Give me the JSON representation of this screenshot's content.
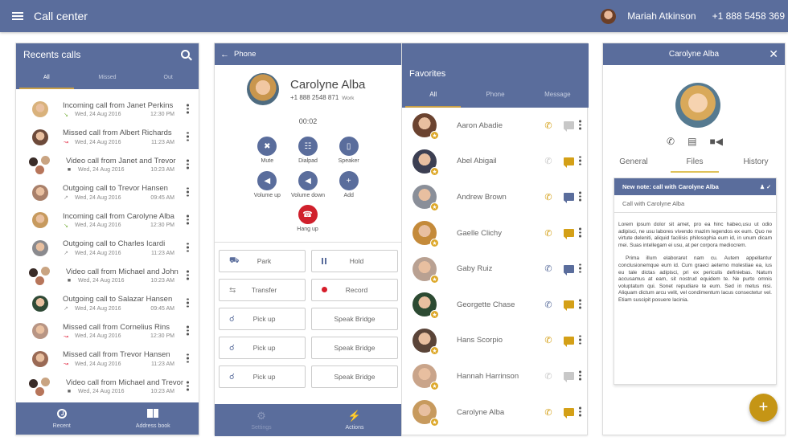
{
  "app": {
    "title": "Call center",
    "menu_icon": "hamburger-icon"
  },
  "user": {
    "name": "Mariah Atkinson",
    "phone": "+1 888 5458 369"
  },
  "recents": {
    "title": "Recents calls",
    "tabs": [
      "All",
      "Missed",
      "Out"
    ],
    "active_tab": "All",
    "items": [
      {
        "title": "Incoming call from Janet Perkins",
        "date": "Wed, 24 Aug 2016",
        "time": "12:30 PM",
        "type": "incoming",
        "group": false,
        "color": "#d9b27c"
      },
      {
        "title": "Missed call from Albert Richards",
        "date": "Wed, 24 Aug 2016",
        "time": "11:23 AM",
        "type": "missed",
        "group": false,
        "color": "#6d4a3a"
      },
      {
        "title": "Video call from Janet and Trevor",
        "date": "Wed, 24 Aug 2016",
        "time": "10:23 AM",
        "type": "video",
        "group": true,
        "color": "#7a5a48"
      },
      {
        "title": "Outgoing call to Trevor Hansen",
        "date": "Wed, 24 Aug 2016",
        "time": "09:45 AM",
        "type": "outgoing",
        "group": false,
        "color": "#a9806a"
      },
      {
        "title": "Incoming call from Carolyne Alba",
        "date": "Wed, 24 Aug 2016",
        "time": "12:30 PM",
        "type": "incoming",
        "group": false,
        "color": "#c79a5e"
      },
      {
        "title": "Outgoing call to Charles Icardi",
        "date": "Wed, 24 Aug 2016",
        "time": "11:23 AM",
        "type": "outgoing",
        "group": false,
        "color": "#8a8a8e"
      },
      {
        "title": "Video call from Michael and John",
        "date": "Wed, 24 Aug 2016",
        "time": "10:23 AM",
        "type": "video",
        "group": true,
        "color": "#7a5a48"
      },
      {
        "title": "Outgoing call to Salazar Hansen",
        "date": "Wed, 24 Aug 2016",
        "time": "09:45 AM",
        "type": "outgoing",
        "group": false,
        "color": "#2f4a36"
      },
      {
        "title": "Missed call from Cornelius Rins",
        "date": "Wed, 24 Aug 2016",
        "time": "12:30 PM",
        "type": "missed",
        "group": false,
        "color": "#b89584"
      },
      {
        "title": "Missed call from Trevor Hansen",
        "date": "Wed, 24 Aug 2016",
        "time": "11:23 AM",
        "type": "missed",
        "group": false,
        "color": "#9a6a55"
      },
      {
        "title": "Video call from Michael and Trevor",
        "date": "Wed, 24 Aug 2016",
        "time": "10:23 AM",
        "type": "video",
        "group": true,
        "color": "#7a5a48"
      }
    ],
    "nav": [
      {
        "label": "Recent",
        "icon": "clock-icon"
      },
      {
        "label": "Address book",
        "icon": "book-icon"
      }
    ]
  },
  "phone": {
    "title": "Phone",
    "caller": {
      "name": "Carolyne Alba",
      "number": "+1 888 2548 871",
      "label": "Work"
    },
    "timer": "00:02",
    "controls": [
      {
        "label": "Mute",
        "icon": "mic-off-icon",
        "glyph": "✖"
      },
      {
        "label": "Dialpad",
        "icon": "dialpad-icon",
        "glyph": "☷"
      },
      {
        "label": "Speaker",
        "icon": "speaker-icon",
        "glyph": "▯"
      },
      {
        "label": "Volume up",
        "icon": "volume-up-icon",
        "glyph": "◀"
      },
      {
        "label": "Volume down",
        "icon": "volume-down-icon",
        "glyph": "◀"
      },
      {
        "label": "Add",
        "icon": "add-person-icon",
        "glyph": "+"
      }
    ],
    "hangup": {
      "label": "Hang up",
      "glyph": "☎"
    },
    "actions": [
      [
        "Park",
        "Hold"
      ],
      [
        "Transfer",
        "Record"
      ],
      [
        "Pick up",
        "Speak Bridge"
      ],
      [
        "Pick up",
        "Speak Bridge"
      ],
      [
        "Pick up",
        "Speak Bridge"
      ]
    ],
    "nav": [
      {
        "label": "Settings",
        "icon": "gear-icon"
      },
      {
        "label": "Actions",
        "icon": "lightning-icon"
      }
    ]
  },
  "favorites": {
    "title": "Favorites",
    "tabs": [
      "All",
      "Phone",
      "Message"
    ],
    "active_tab": "All",
    "items": [
      {
        "name": "Aaron Abadie",
        "phone": "#d4a017",
        "msg": "#c8c8c8",
        "avatar": "#6b4330"
      },
      {
        "name": "Abel Abigail",
        "phone": "#c8c8c8",
        "msg": "#d4a017",
        "avatar": "#3c3f52"
      },
      {
        "name": "Andrew Brown",
        "phone": "#d4a017",
        "msg": "#5a6d9c",
        "avatar": "#8a8f99"
      },
      {
        "name": "Gaelle Clichy",
        "phone": "#d4a017",
        "msg": "#d4a017",
        "avatar": "#c48a3a"
      },
      {
        "name": "Gaby Ruiz",
        "phone": "#5a6d9c",
        "msg": "#5a6d9c",
        "avatar": "#b9a192"
      },
      {
        "name": "Georgette Chase",
        "phone": "#5a6d9c",
        "msg": "#d4a017",
        "avatar": "#2c4a32"
      },
      {
        "name": "Hans Scorpio",
        "phone": "#d4a017",
        "msg": "#d4a017",
        "avatar": "#5a4438"
      },
      {
        "name": "Hannah Harrinson",
        "phone": "#c8c8c8",
        "msg": "#c8c8c8",
        "avatar": "#c9a48a"
      },
      {
        "name": "Carolyne Alba",
        "phone": "#d4a017",
        "msg": "#d4a017",
        "avatar": "#c79a5e"
      }
    ]
  },
  "detail": {
    "title": "Carolyne Alba",
    "tabs": [
      "General",
      "Files",
      "History"
    ],
    "active_tab": "Files",
    "note": {
      "header": "New note: call with Carolyne Alba",
      "subject": "Call with Carolyne Alba",
      "paragraphs": [
        "Lorem ipsum dolor sit amet, pro ea hinc habeo,usu ut odio adipisci, ne usu labores vivendo mazim legendos ex eum. Quo ne virtute deleniti, aliquid facilisis philosophia eum id, in unum dicam mei. Suas intellegam ei usu, at per corpora mediocrem.",
        "Prima illum elaboraret nam cu. Autem appellantur conclusionemque eum id. Cum graeci aeterno molestiae ea, ius eu tale dictas adipisci, pri ex periculis definiebas. Natum accusamus at eam, sit nostrud equidem te. Ne purto omnis voluptatum qui. Sonet repudiare te eum. Sed in metus nisi. Aliquam dictum arcu velit, vel condimentum lacus consectetur vel. Etiam suscipit posuere lacinia."
      ]
    },
    "fab_label": "+"
  },
  "colors": {
    "primary": "#5a6d9c",
    "accent": "#c9a047",
    "danger": "#d0202c",
    "fab": "#c59515"
  }
}
